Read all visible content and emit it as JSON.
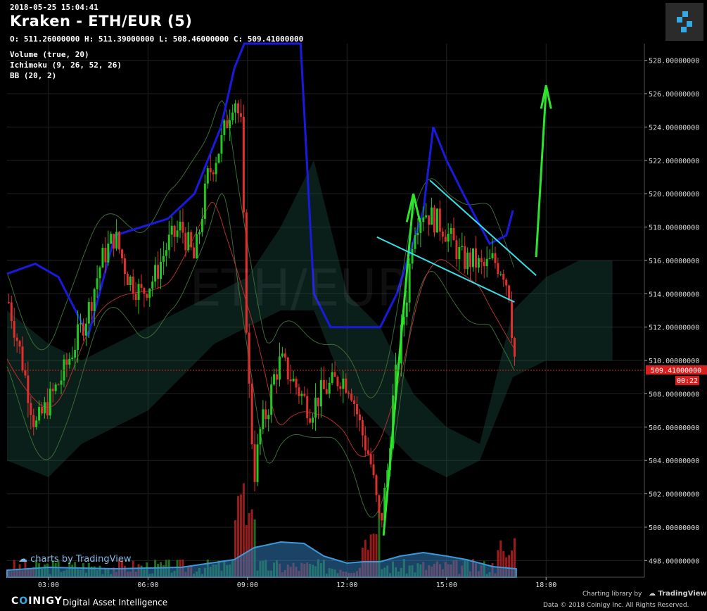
{
  "header": {
    "datetime": "2018-05-25 15:04:41",
    "title": "Kraken - ETH/EUR (5)",
    "ohlc": "O: 511.26000000 H: 511.39000000 L: 508.46000000 C: 509.41000000"
  },
  "indicators": [
    "Volume (true, 20)",
    "Ichimoku (9, 26, 52, 26)",
    "BB (20, 2)"
  ],
  "watermark": {
    "symbol": "ETH/EUR",
    "tradingview": "charts by TradingView"
  },
  "footer": {
    "brand_prefix": "C",
    "brand_o": "O",
    "brand_suffix": "INIGY",
    "tagline": "Digital Asset Intelligence",
    "library": "Charting library by",
    "library_name": "TradingView",
    "copyright": "Data © 2018  Coinigy Inc. All Rights Reserved."
  },
  "colors": {
    "up": "#22c722",
    "down": "#e0302e",
    "cloud": "#1f5a4a",
    "kijun_thick": "#1a1adf",
    "annotation_arrow": "#2ce52c",
    "annotation_line": "#36e0e6",
    "last_price": "#d91e1e"
  },
  "chart_data": {
    "type": "candlestick",
    "ylim": [
      497,
      529
    ],
    "yticks": [
      "498.00000000",
      "500.00000000",
      "502.00000000",
      "504.00000000",
      "506.00000000",
      "508.00000000",
      "510.00000000",
      "512.00000000",
      "514.00000000",
      "516.00000000",
      "518.00000000",
      "520.00000000",
      "522.00000000",
      "524.00000000",
      "526.00000000",
      "528.00000000"
    ],
    "ytick_values": [
      498,
      500,
      502,
      504,
      506,
      508,
      510,
      512,
      514,
      516,
      518,
      520,
      522,
      524,
      526,
      528
    ],
    "xticks": [
      "03:00",
      "06:00",
      "09:00",
      "12:00",
      "15:00",
      "18:00"
    ],
    "xtick_hours": [
      3,
      6,
      9,
      12,
      15,
      18
    ],
    "xlim_hours": [
      1.75,
      20.9
    ],
    "last_price": {
      "value": 509.41,
      "label": "509.41000000",
      "countdown": "00:22"
    },
    "series": [
      {
        "name": "close",
        "x_hours": [
          1.8,
          2.2,
          2.6,
          3.0,
          3.4,
          3.8,
          4.2,
          4.6,
          5.0,
          5.4,
          5.8,
          6.2,
          6.6,
          7.0,
          7.4,
          7.8,
          8.2,
          8.6,
          8.8,
          9.0,
          9.2,
          9.4,
          9.6,
          9.8,
          10.0,
          10.3,
          10.6,
          10.9,
          11.2,
          11.5,
          11.8,
          12.1,
          12.4,
          12.7,
          13.0,
          13.2,
          13.4,
          13.6,
          13.8,
          14.0,
          14.3,
          14.6,
          14.9,
          15.2,
          15.5,
          15.8,
          16.1,
          16.4,
          16.7,
          16.9,
          17.0,
          17.1
        ],
        "values": [
          513.5,
          510,
          506,
          507.5,
          509,
          511,
          513,
          516,
          517.5,
          515,
          514,
          515,
          517,
          518,
          516,
          521,
          523,
          526,
          524,
          510,
          503,
          506,
          507,
          509,
          510,
          509,
          508,
          507,
          508,
          508.5,
          509,
          508.5,
          506,
          504,
          500,
          503,
          508,
          511,
          514,
          518,
          519,
          518.5,
          518,
          517,
          516,
          516,
          515.5,
          516,
          515.5,
          514,
          511,
          509.41
        ]
      }
    ],
    "annotations": [
      "up-arrow 13.1→14.0 (499.5→520)",
      "up-arrow 17.7→18.0 (516→526.5)",
      "falling wedge lines"
    ]
  }
}
